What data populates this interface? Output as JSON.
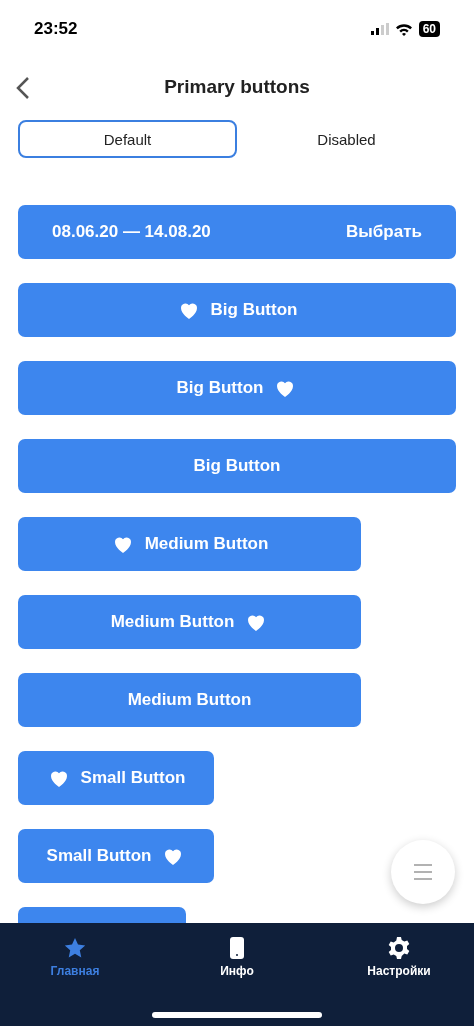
{
  "status_bar": {
    "time": "23:52",
    "battery": "60"
  },
  "header": {
    "title": "Primary buttons"
  },
  "tabs": [
    {
      "label": "Default",
      "selected": true
    },
    {
      "label": "Disabled",
      "selected": false
    }
  ],
  "buttons": [
    {
      "kind": "range",
      "label": "08.06.20 — 14.08.20",
      "action": "Выбрать"
    },
    {
      "kind": "big-heart-left",
      "label": "Big Button"
    },
    {
      "kind": "big-heart-right",
      "label": "Big Button"
    },
    {
      "kind": "big-plain",
      "label": "Big Button"
    },
    {
      "kind": "medium-heart-left",
      "label": "Medium Button"
    },
    {
      "kind": "medium-heart-right",
      "label": "Medium Button"
    },
    {
      "kind": "medium-plain",
      "label": "Medium Button"
    },
    {
      "kind": "small-heart-left",
      "label": "Small Button"
    },
    {
      "kind": "small-heart-right",
      "label": "Small Button"
    },
    {
      "kind": "small-cut"
    }
  ],
  "nav": [
    {
      "label": "Главная",
      "selected": true
    },
    {
      "label": "Инфо",
      "selected": false
    },
    {
      "label": "Настройки",
      "selected": false
    }
  ]
}
